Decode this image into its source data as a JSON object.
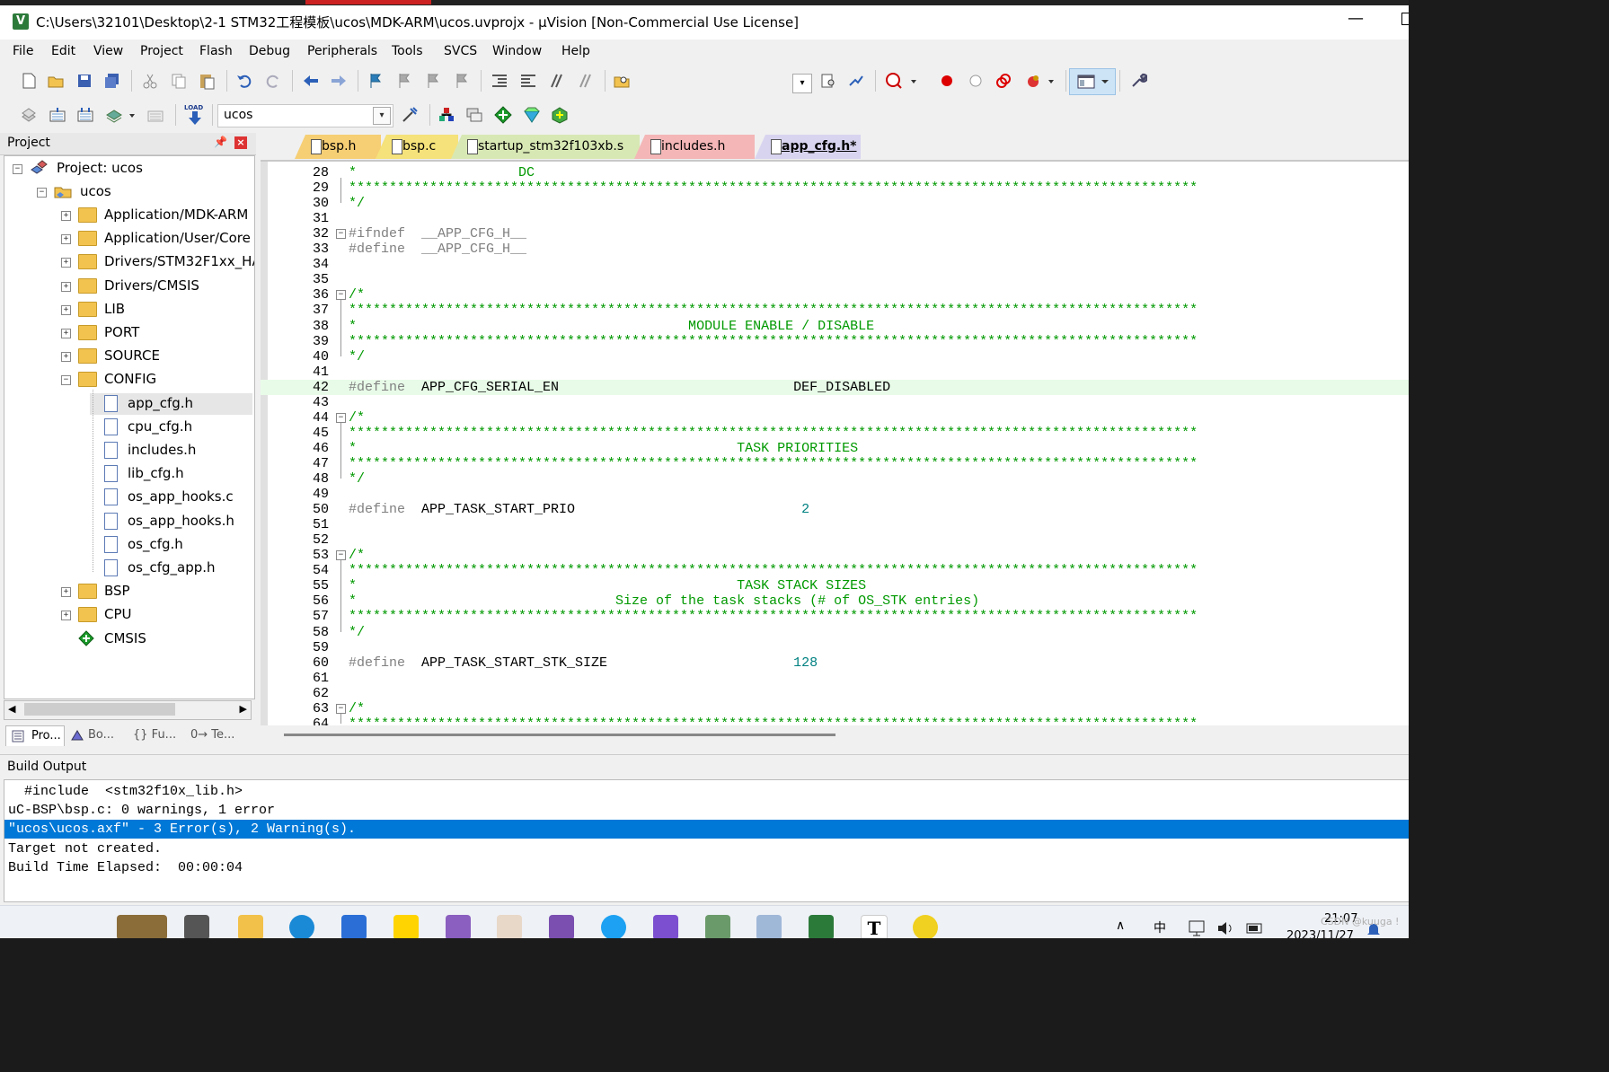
{
  "window": {
    "title": "C:\\Users\\32101\\Desktop\\2-1 STM32工程模板\\ucos\\MDK-ARM\\ucos.uvprojx - µVision  [Non-Commercial Use License]",
    "minimize_glyph": "—"
  },
  "menu": [
    "File",
    "Edit",
    "View",
    "Project",
    "Flash",
    "Debug",
    "Peripherals",
    "Tools",
    "SVCS",
    "Window",
    "Help"
  ],
  "toolbar": {
    "target_name": "ucos",
    "load_label": "LOAD"
  },
  "project_panel": {
    "title": "Project",
    "root": "Project: ucos",
    "target": "ucos",
    "groups": [
      "Application/MDK-ARM",
      "Application/User/Core",
      "Drivers/STM32F1xx_HAL",
      "Drivers/CMSIS",
      "LIB",
      "PORT",
      "SOURCE",
      "CONFIG"
    ],
    "config_files": [
      "app_cfg.h",
      "cpu_cfg.h",
      "includes.h",
      "lib_cfg.h",
      "os_app_hooks.c",
      "os_app_hooks.h",
      "os_cfg.h",
      "os_cfg_app.h"
    ],
    "groups_after": [
      "BSP",
      "CPU",
      "CMSIS"
    ],
    "bottom_tabs": [
      "Pro...",
      "Bo...",
      "{} Fu...",
      "0→ Te..."
    ]
  },
  "editor_tabs": [
    {
      "label": "bsp.h",
      "color": "#f6ce74"
    },
    {
      "label": "bsp.c",
      "color": "#f5e27a"
    },
    {
      "label": "startup_stm32f103xb.s",
      "color": "#d8e8b4"
    },
    {
      "label": "includes.h",
      "color": "#f4b6b6"
    },
    {
      "label": "app_cfg.h*",
      "color": "#d8d4f0"
    }
  ],
  "code_lines": [
    {
      "n": "28",
      "text": "*                    DC"
    },
    {
      "n": "29",
      "text": "*********************************************************************************************************"
    },
    {
      "n": "30",
      "text": "*/"
    },
    {
      "n": "31",
      "text": ""
    },
    {
      "n": "32",
      "text": "#ifndef  __APP_CFG_H__"
    },
    {
      "n": "33",
      "text": "#define  __APP_CFG_H__"
    },
    {
      "n": "34",
      "text": ""
    },
    {
      "n": "35",
      "text": ""
    },
    {
      "n": "36",
      "text": "/*"
    },
    {
      "n": "37",
      "text": "*********************************************************************************************************"
    },
    {
      "n": "38",
      "text": "*                                         MODULE ENABLE / DISABLE"
    },
    {
      "n": "39",
      "text": "*********************************************************************************************************"
    },
    {
      "n": "40",
      "text": "*/"
    },
    {
      "n": "41",
      "text": ""
    },
    {
      "n": "42",
      "text": "#define  APP_CFG_SERIAL_EN                             DEF_DISABLED"
    },
    {
      "n": "43",
      "text": ""
    },
    {
      "n": "44",
      "text": "/*"
    },
    {
      "n": "45",
      "text": "*********************************************************************************************************"
    },
    {
      "n": "46",
      "text": "*                                               TASK PRIORITIES"
    },
    {
      "n": "47",
      "text": "*********************************************************************************************************"
    },
    {
      "n": "48",
      "text": "*/"
    },
    {
      "n": "49",
      "text": ""
    },
    {
      "n": "50",
      "text": "#define  APP_TASK_START_PRIO                            2"
    },
    {
      "n": "51",
      "text": ""
    },
    {
      "n": "52",
      "text": ""
    },
    {
      "n": "53",
      "text": "/*"
    },
    {
      "n": "54",
      "text": "*********************************************************************************************************"
    },
    {
      "n": "55",
      "text": "*                                               TASK STACK SIZES"
    },
    {
      "n": "56",
      "text": "*                                Size of the task stacks (# of OS_STK entries)"
    },
    {
      "n": "57",
      "text": "*********************************************************************************************************"
    },
    {
      "n": "58",
      "text": "*/"
    },
    {
      "n": "59",
      "text": ""
    },
    {
      "n": "60",
      "text": "#define  APP_TASK_START_STK_SIZE                       128"
    },
    {
      "n": "61",
      "text": ""
    },
    {
      "n": "62",
      "text": ""
    },
    {
      "n": "63",
      "text": "/*"
    },
    {
      "n": "64",
      "text": "*********************************************************************************************************"
    }
  ],
  "build_output": {
    "title": "Build Output",
    "lines": [
      "  #include  <stm32f10x_lib.h>",
      "uC-BSP\\bsp.c: 0 warnings, 1 error",
      "\"ucos\\ucos.axf\" - 3 Error(s), 2 Warning(s).",
      "Target not created.",
      "Build Time Elapsed:  00:00:04"
    ],
    "selected_index": 2
  },
  "taskbar": {
    "ime": "中",
    "time": "21:07",
    "date": "2023/11/27",
    "watermark": "CSDN @kuuga !"
  },
  "colors": {
    "selection": "#0078d7",
    "comment": "#009900",
    "number": "#008080",
    "preprocessor": "#808080",
    "current_line": "#e8fbe8"
  }
}
